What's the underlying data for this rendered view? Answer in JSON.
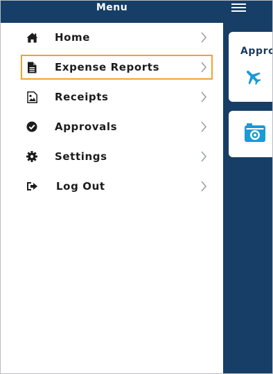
{
  "drawer": {
    "title": "Menu",
    "items": [
      {
        "label": "Home",
        "icon": "home-icon"
      },
      {
        "label": "Expense Reports",
        "icon": "document-icon",
        "active": true
      },
      {
        "label": "Receipts",
        "icon": "image-icon"
      },
      {
        "label": "Approvals",
        "icon": "check-circle-icon"
      },
      {
        "label": "Settings",
        "icon": "gear-icon"
      },
      {
        "label": "Log Out",
        "icon": "sign-out-icon"
      }
    ]
  },
  "background": {
    "menu_icon": "hamburger-icon",
    "cards": [
      {
        "title": "Appro",
        "icon": "airplane-icon"
      },
      {
        "title": "",
        "icon": "camera-icon"
      }
    ]
  },
  "colors": {
    "navy": "#163e66",
    "highlight_border": "#f2a22c",
    "icon_blue": "#1b9ad6",
    "text_dark": "#1c1c1c"
  }
}
